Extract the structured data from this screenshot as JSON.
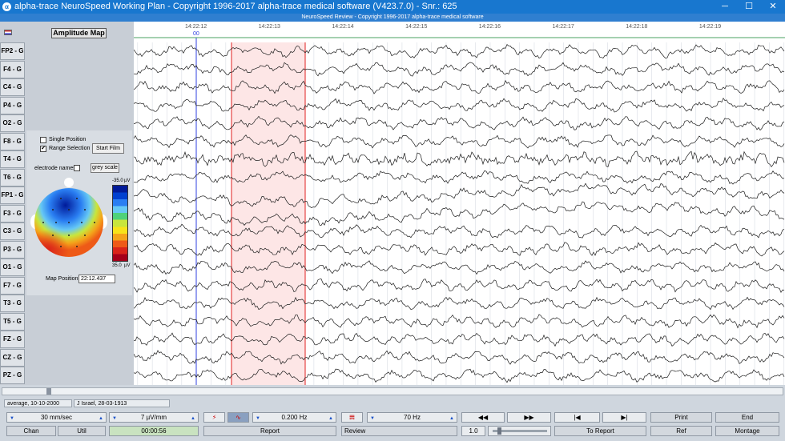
{
  "window": {
    "title": "alpha-trace NeuroSpeed Working Plan - Copyright 1996-2017 alpha-trace medical software (V423.7.0) - Snr.: 625",
    "subtitle": "NeuroSpeed Review - Copyright 1996-2017 alpha-trace medical software",
    "minimize": "─",
    "maximize": "☐",
    "close": "✕"
  },
  "left": {
    "amplitude_map_label": "Amplitude Map",
    "channels": [
      "FP2 - G",
      "F4 - G",
      "C4 - G",
      "P4 - G",
      "O2 - G",
      "F8 - G",
      "T4 - G",
      "T6 - G",
      "FP1 - G",
      "F3 - G",
      "C3 - G",
      "P3 - G",
      "O1 - G",
      "F7 - G",
      "T3 - G",
      "T5 - G",
      "FZ - G",
      "CZ - G",
      "PZ - G"
    ],
    "single_position": "Single Position",
    "range_selection": "Range Selection",
    "start_film": "Start Film",
    "electrode_names": "electrode names",
    "grey_scale": "grey scale",
    "scale_top": "-35.0",
    "scale_bottom": "35.0",
    "scale_unit": "µV",
    "map_position_label": "Map Position:",
    "map_position_value": "22:12.437",
    "colors": [
      "#001a99",
      "#0040d0",
      "#2a7ef2",
      "#66c8f5",
      "#4fd27a",
      "#c8e63c",
      "#f7e31a",
      "#f4a41a",
      "#ee5a17",
      "#d9241a",
      "#a5001a"
    ]
  },
  "eeg": {
    "times": [
      "14:22:12",
      "14:22:13",
      "14:22:14",
      "14:22:15",
      "14:22:16",
      "14:22:17",
      "14:22:18",
      "14:22:19"
    ],
    "cursor_label": "00"
  },
  "status": {
    "montage_desc": "average, 10-10-2000",
    "patient": "J Israel, 28-03-1913"
  },
  "controls": {
    "speed": "30 mm/sec",
    "sensitivity": "7 µV/mm",
    "low_filter": "0.200 Hz",
    "high_filter": "70 Hz",
    "print": "Print",
    "end": "End",
    "chan": "Chan",
    "util": "Util",
    "elapsed": "00:00:56",
    "report": "Report",
    "review": "Review",
    "zoom": "1.0",
    "to_report": "To Report",
    "ref": "Ref",
    "montage": "Montage",
    "rewind": "◀◀",
    "forward": "▶▶",
    "to_start": "|◀",
    "to_end": "▶|"
  }
}
